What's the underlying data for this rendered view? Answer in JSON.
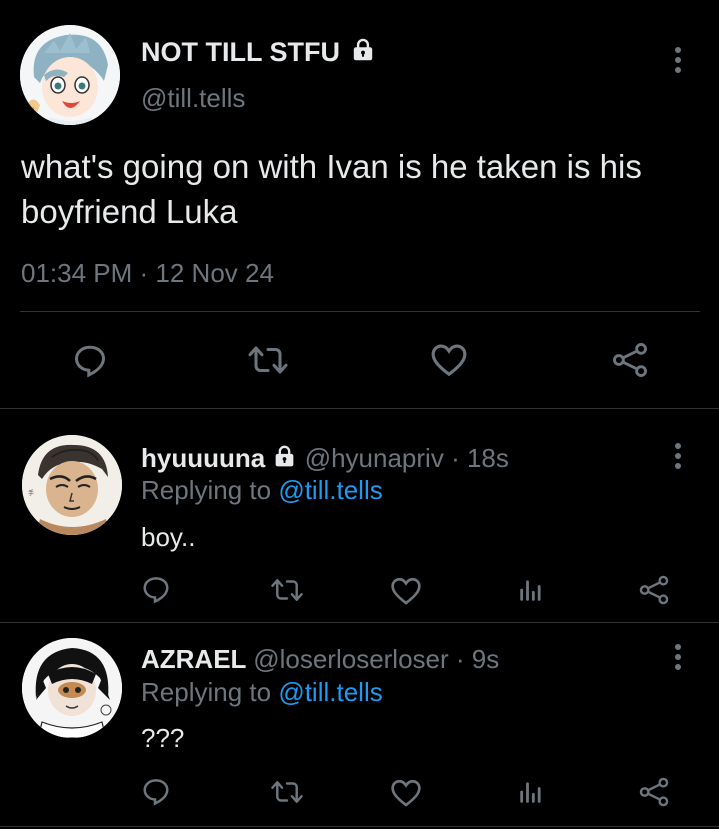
{
  "main_tweet": {
    "display_name": "NOT TILL STFU",
    "handle": "@till.tells",
    "text_line1": "what's going on with Ivan is he taken is his",
    "text_line2": "boyfriend Luka",
    "timestamp": "01:34 PM · 12 Nov 24"
  },
  "replies": [
    {
      "display_name": "hyuuuuna",
      "handle": "@hyunapriv",
      "time": "· 18s",
      "replying_prefix": "Replying to",
      "replying_to": "@till.tells",
      "text": "boy.."
    },
    {
      "display_name": "AZRAEL",
      "handle": "@loserloserloser",
      "time": "· 9s",
      "replying_prefix": "Replying to",
      "replying_to": "@till.tells",
      "text": "???"
    }
  ],
  "icons": {
    "reply": "reply-icon",
    "retweet": "retweet-icon",
    "like": "like-icon",
    "stats": "stats-icon",
    "share": "share-icon",
    "more": "more-icon",
    "lock": "lock-icon"
  },
  "colors": {
    "background": "#000000",
    "text": "#e7e9ea",
    "muted": "#6e767d",
    "link": "#1d9bf0",
    "divider": "#2f3336"
  }
}
